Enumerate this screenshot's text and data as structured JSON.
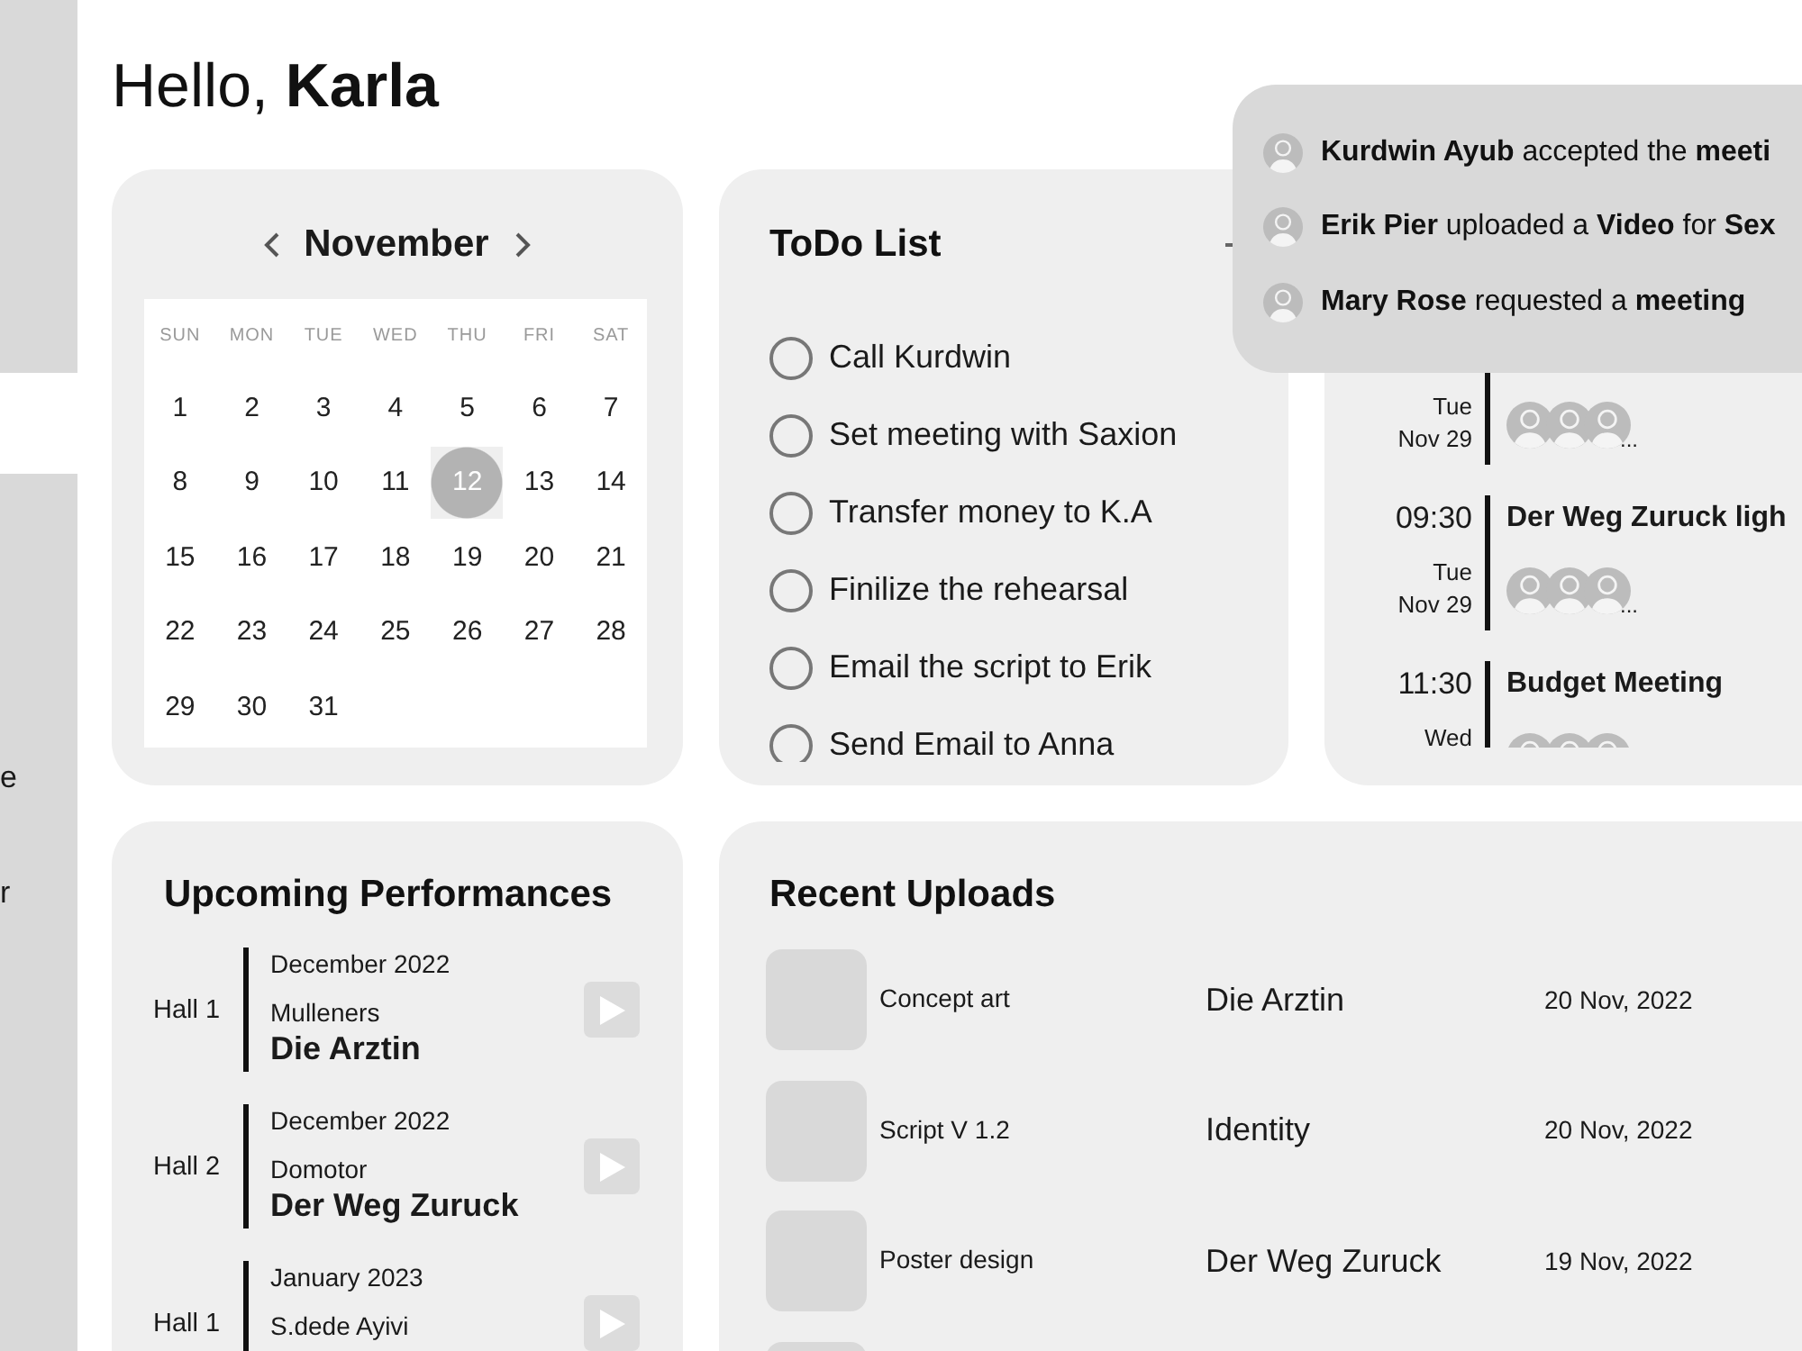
{
  "greeting": "Hello, **Karla**",
  "sidebar": {
    "items": [
      {
        "label": "e"
      },
      {
        "label": "r"
      }
    ]
  },
  "calendar": {
    "month": "November",
    "weekdays": [
      "SUN",
      "MON",
      "TUE",
      "WED",
      "THU",
      "FRI",
      "SAT"
    ],
    "days": [
      {
        "label": "1",
        "selected": false
      },
      {
        "label": "2",
        "selected": false
      },
      {
        "label": "3",
        "selected": false
      },
      {
        "label": "4",
        "selected": false
      },
      {
        "label": "5",
        "selected": false
      },
      {
        "label": "6",
        "selected": false
      },
      {
        "label": "7",
        "selected": false
      },
      {
        "label": "8",
        "selected": false
      },
      {
        "label": "9",
        "selected": false
      },
      {
        "label": "10",
        "selected": false
      },
      {
        "label": "11",
        "selected": false
      },
      {
        "label": "12",
        "selected": true
      },
      {
        "label": "13",
        "selected": false
      },
      {
        "label": "14",
        "selected": false
      },
      {
        "label": "15",
        "selected": false
      },
      {
        "label": "16",
        "selected": false
      },
      {
        "label": "17",
        "selected": false
      },
      {
        "label": "18",
        "selected": false
      },
      {
        "label": "19",
        "selected": false
      },
      {
        "label": "20",
        "selected": false
      },
      {
        "label": "21",
        "selected": false
      },
      {
        "label": "22",
        "selected": false
      },
      {
        "label": "23",
        "selected": false
      },
      {
        "label": "24",
        "selected": false
      },
      {
        "label": "25",
        "selected": false
      },
      {
        "label": "26",
        "selected": false
      },
      {
        "label": "27",
        "selected": false
      },
      {
        "label": "28",
        "selected": false
      },
      {
        "label": "29",
        "selected": false
      },
      {
        "label": "30",
        "selected": false
      },
      {
        "label": "31",
        "selected": false
      }
    ]
  },
  "todo": {
    "title": "ToDo List",
    "items": [
      {
        "text": "Call Kurdwin",
        "checked": false
      },
      {
        "text": "Set meeting with Saxion",
        "checked": false
      },
      {
        "text": "Transfer money to K.A",
        "checked": false
      },
      {
        "text": "Finilize the rehearsal",
        "checked": false
      },
      {
        "text": "Email the script to Erik",
        "checked": false
      },
      {
        "text": "Send Email to Anna",
        "checked": false
      }
    ]
  },
  "meetings": {
    "rows": [
      {
        "day": "Tue",
        "date": "Nov 29",
        "more": "..."
      },
      {
        "time": "09:30",
        "title": "Der Weg Zuruck ligh",
        "day": "Tue",
        "date": "Nov 29",
        "more": "..."
      },
      {
        "time": "11:30",
        "title": "Budget Meeting",
        "day": "Wed"
      }
    ]
  },
  "notifications": [
    {
      "text": "**Kurdwin Ayub** accepted the **meeti**"
    },
    {
      "text": "**Erik Pier** uploaded a **Video** for **Sex**"
    },
    {
      "text": "**Mary Rose** requested a **meeting**"
    }
  ],
  "performances": {
    "title": "Upcoming Performances",
    "items": [
      {
        "hall": "Hall 1",
        "date": "December 2022",
        "company": "Mulleners",
        "title": "Die Arztin"
      },
      {
        "hall": "Hall 2",
        "date": "December 2022",
        "company": "Domotor",
        "title": "Der Weg Zuruck"
      },
      {
        "hall": "Hall 1",
        "date": "January 2023",
        "company": "S.dede Ayivi"
      }
    ]
  },
  "uploads": {
    "title": "Recent Uploads",
    "rows": [
      {
        "name": "Concept art",
        "project": "Die Arztin",
        "date": "20 Nov, 2022"
      },
      {
        "name": "Script V 1.2",
        "project": "Identity",
        "date": "20 Nov, 2022"
      },
      {
        "name": "Poster design",
        "project": "Der Weg Zuruck",
        "date": "19 Nov, 2022"
      },
      {}
    ]
  }
}
